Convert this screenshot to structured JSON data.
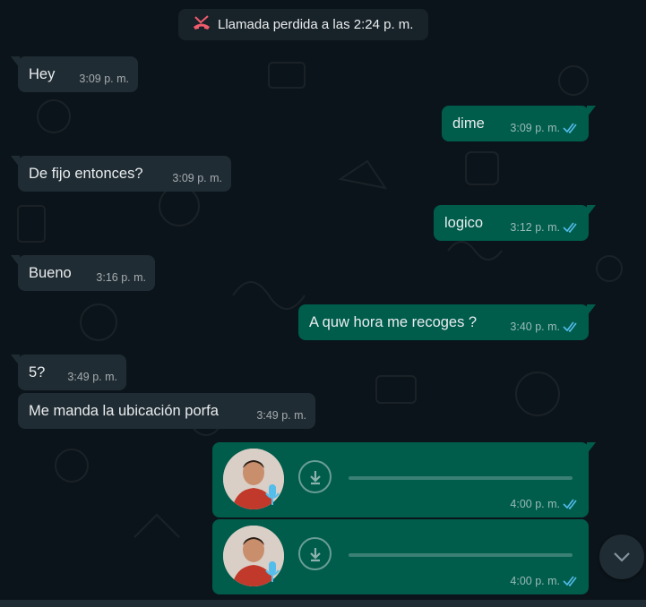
{
  "system": {
    "missed_call": "Llamada perdida a las 2:24 p. m.",
    "icon": "missed-call-icon",
    "icon_color": "#f15c6d"
  },
  "messages": [
    {
      "dir": "in",
      "text": "Hey",
      "time": "3:09 p. m."
    },
    {
      "dir": "out",
      "text": "dime",
      "time": "3:09 p. m.",
      "status": "read"
    },
    {
      "dir": "in",
      "text": "De fijo entonces?",
      "time": "3:09 p. m."
    },
    {
      "dir": "out",
      "text": "logico",
      "time": "3:12 p. m.",
      "status": "read"
    },
    {
      "dir": "in",
      "text": "Bueno",
      "time": "3:16 p. m."
    },
    {
      "dir": "out",
      "text": "A quw hora me recoges ?",
      "time": "3:40 p. m.",
      "status": "read"
    },
    {
      "dir": "in",
      "text": "5?",
      "time": "3:49 p. m."
    },
    {
      "dir": "in",
      "text": "Me manda la ubicación porfa",
      "time": "3:49 p. m."
    }
  ],
  "voice_notes": [
    {
      "time": "4:00 p. m.",
      "status": "read",
      "icon": "download-icon"
    },
    {
      "time": "4:00 p. m.",
      "status": "read",
      "icon": "download-icon"
    }
  ],
  "colors": {
    "background": "#0b141a",
    "incoming": "#202c33",
    "outgoing": "#005c4b",
    "read_tick": "#53bdeb"
  },
  "scroll_button_icon": "chevron-down-icon"
}
